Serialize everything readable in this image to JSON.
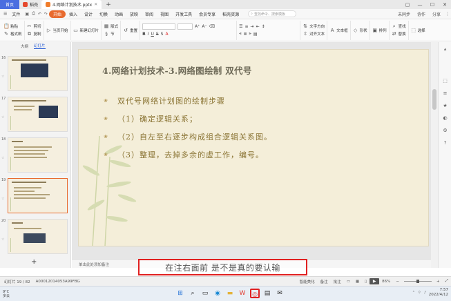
{
  "titlebar": {
    "tabs": [
      {
        "label": "首页",
        "kind": "home"
      },
      {
        "label": "稻壳",
        "kind": "docer"
      },
      {
        "label": "4.网络计划技术.pptx",
        "kind": "doc"
      }
    ],
    "new_tab": "+"
  },
  "menu": {
    "file": "文件",
    "items": [
      "开始",
      "插入",
      "设计",
      "切换",
      "动画",
      "放映",
      "审阅",
      "视图",
      "开发工具",
      "会员专享",
      "稻壳资源"
    ],
    "search_placeholder": "查找命令、搜索模板",
    "right": [
      "未同步",
      "协作",
      "分享"
    ]
  },
  "ribbon": {
    "paste": "粘贴",
    "cut": "剪切",
    "copy": "复制",
    "format_painter": "格式刷",
    "current_start": "当页开始",
    "new_slide": "新建幻灯片",
    "layout": "版式",
    "section": "节",
    "reset": "重置",
    "text_direction": "文字方向",
    "align_text": "对齐文本",
    "textbox": "文本框",
    "shapes": "形状",
    "arrange": "排列",
    "find": "查找",
    "replace": "替换",
    "select": "选择"
  },
  "leftpanel": {
    "tabs": [
      "大纲",
      "幻灯片"
    ],
    "thumbs": [
      {
        "num": "16"
      },
      {
        "num": "17"
      },
      {
        "num": "18"
      },
      {
        "num": "19"
      },
      {
        "num": "20"
      }
    ],
    "add": "+"
  },
  "slide": {
    "title": "4.网络计划技术-3.网络图绘制 双代号",
    "lines": [
      "双代号网络计划图的绘制步骤",
      "（1）确定逻辑关系；",
      "（2）自左至右逐步构成组合逻辑关系图。",
      "（3）整理，去掉多余的虚工作，编号。"
    ],
    "bullet": "❀"
  },
  "notes": {
    "placeholder": "单击此处添加备注"
  },
  "subtitle": "在注右面前 是不是真的要认输",
  "status": {
    "slide_info": "幻灯片 19 / 82",
    "file_code": "A00012014053A99FBG",
    "smart_beautify": "智能美化",
    "notes": "备注",
    "comments": "批注",
    "zoom": "86%"
  },
  "taskbar": {
    "weather_temp": "9°C",
    "weather_desc": "多云",
    "time": "7:57",
    "date": "2022/4/12"
  },
  "colors": {
    "accent_orange": "#e86a2e",
    "home_blue": "#4a6ee0",
    "slide_bg": "#f4eed9",
    "slide_text": "#8a7434",
    "highlight_red": "#e02020"
  }
}
